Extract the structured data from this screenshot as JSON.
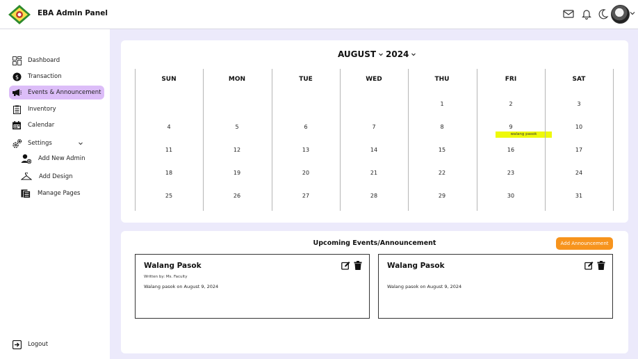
{
  "header": {
    "app_title": "EBA Admin Panel",
    "icons": [
      "mail-icon",
      "bell-icon",
      "moon-icon",
      "avatar",
      "chevron-down-icon"
    ]
  },
  "sidebar": {
    "items": [
      {
        "label": "Dashboard",
        "icon": "dashboard-icon"
      },
      {
        "label": "Transaction",
        "icon": "coin-icon"
      },
      {
        "label": "Events & Announcement",
        "icon": "megaphone-icon",
        "active": true
      },
      {
        "label": "Inventory",
        "icon": "clipboard-icon"
      },
      {
        "label": "Calendar",
        "icon": "calendar-icon"
      },
      {
        "label": "Settings",
        "icon": "gears-icon"
      }
    ],
    "settings_subitems": [
      {
        "label": "Add New Admin",
        "icon": "add-user-icon"
      },
      {
        "label": "Add Design",
        "icon": "hanger-icon"
      },
      {
        "label": "Manage Pages",
        "icon": "pages-icon"
      }
    ],
    "logout_label": "Logout"
  },
  "calendar": {
    "month": "AUGUST",
    "year": "2024",
    "day_headers": [
      "SUN",
      "MON",
      "TUE",
      "WED",
      "THU",
      "FRI",
      "SAT"
    ],
    "weeks": [
      [
        "",
        "",
        "",
        "",
        "1",
        "2",
        "3"
      ],
      [
        "4",
        "5",
        "6",
        "7",
        "8",
        "9",
        "10"
      ],
      [
        "11",
        "12",
        "13",
        "14",
        "15",
        "16",
        "17"
      ],
      [
        "18",
        "19",
        "20",
        "21",
        "22",
        "23",
        "24"
      ],
      [
        "25",
        "26",
        "27",
        "28",
        "29",
        "30",
        "31"
      ]
    ],
    "event_chip": "walang pasok",
    "accent_colors": {
      "active_nav": "#dcbdf8",
      "event_chip": "#eef90a",
      "button": "#f7941d",
      "background": "#eceafb"
    }
  },
  "events": {
    "title": "Upcoming Events/Announcement",
    "add_button": "Add Announcement",
    "cards": [
      {
        "heading": "Walang Pasok",
        "author": "Written by: Ms. Faculty",
        "body": "Walang pasok on August 9, 2024"
      },
      {
        "heading": "Walang Pasok",
        "author": "",
        "body": "Walang pasok on August 9, 2024"
      }
    ]
  }
}
